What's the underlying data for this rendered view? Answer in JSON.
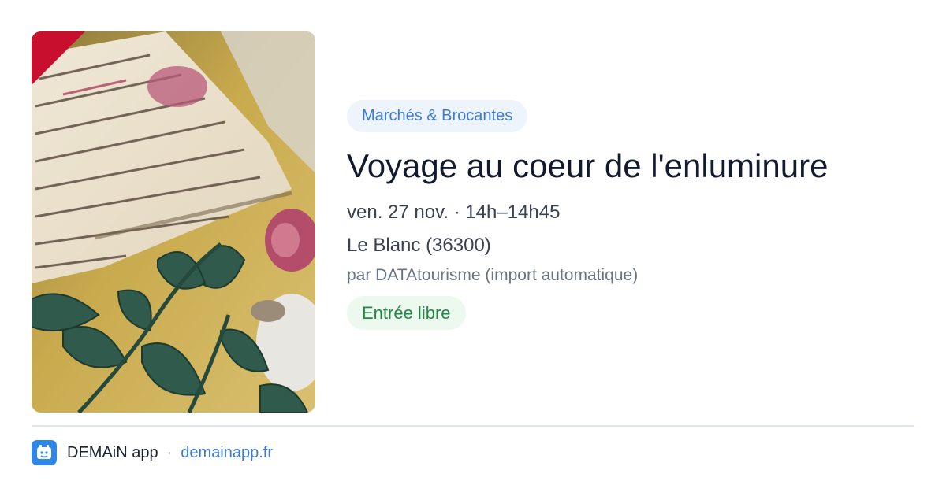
{
  "event": {
    "category": "Marchés & Brocantes",
    "title": "Voyage au coeur de l'enluminure",
    "datetime": "ven. 27 nov. · 14h–14h45",
    "location": "Le Blanc (36300)",
    "organizer": "par DATAtourisme (import automatique)",
    "price": "Entrée libre",
    "image_description_icon": "illuminated-manuscript-photo"
  },
  "footer": {
    "app_name": "DEMAiN app",
    "separator": "·",
    "url": "demainapp.fr",
    "logo_icon": "demain-app-logo-icon"
  },
  "colors": {
    "accent_blue": "#3b7ad6",
    "chip_blue_bg": "#eef4fc",
    "chip_green_bg": "#edf8ef",
    "chip_green_text": "#1f8a45",
    "corner_ribbon": "#c8102e"
  }
}
